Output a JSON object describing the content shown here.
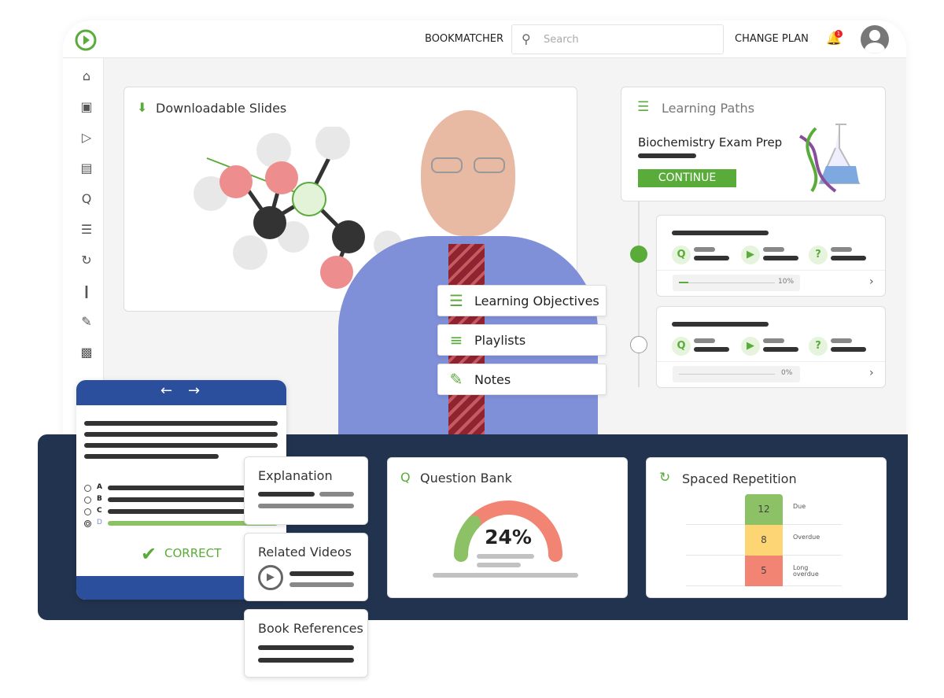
{
  "header": {
    "bookmatcher": "BOOKMATCHER",
    "search_placeholder": "Search",
    "change_plan": "CHANGE PLAN",
    "notification_count": "1"
  },
  "sidebar": {
    "icons": [
      "home-icon",
      "clipboard-icon",
      "video-library-icon",
      "articles-icon",
      "question-bank-icon",
      "learning-paths-icon",
      "spaced-repetition-icon",
      "bookmark-icon",
      "notes-icon",
      "stats-icon"
    ]
  },
  "slides": {
    "title": "Downloadable Slides"
  },
  "learning_paths": {
    "title": "Learning Paths",
    "course": "Biochemistry Exam Prep",
    "continue": "CONTINUE",
    "steps": [
      {
        "progress": "10%",
        "value": 10,
        "active": true
      },
      {
        "progress": "0%",
        "value": 0,
        "active": false
      }
    ]
  },
  "menu": {
    "objectives": "Learning Objectives",
    "playlists": "Playlists",
    "notes": "Notes"
  },
  "quiz": {
    "options": [
      "A",
      "B",
      "C",
      "D"
    ],
    "selected": "D",
    "result": "CORRECT"
  },
  "explanation": {
    "title": "Explanation"
  },
  "related_videos": {
    "title": "Related Videos"
  },
  "book_references": {
    "title": "Book References"
  },
  "question_bank": {
    "title": "Question Bank",
    "percent": "24%",
    "value": 24
  },
  "spaced_repetition": {
    "title": "Spaced Repetition",
    "rows": [
      {
        "count": "12",
        "label": "Due",
        "color": "#8cc265"
      },
      {
        "count": "8",
        "label": "Overdue",
        "color": "#fdd574"
      },
      {
        "count": "5",
        "label": "Long overdue",
        "color": "#f28474"
      }
    ]
  },
  "colors": {
    "accent": "#5aac3a",
    "navy": "#22334f",
    "quiz_blue": "#2b4f9c",
    "gauge_red": "#f28474"
  }
}
